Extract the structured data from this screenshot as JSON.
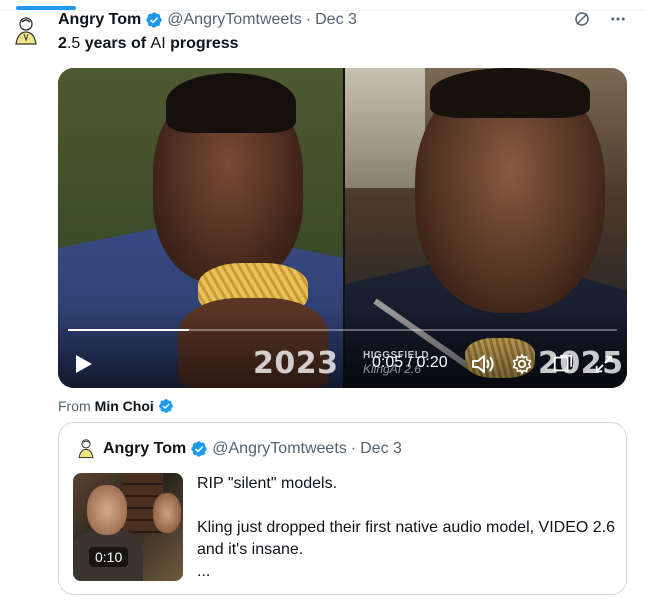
{
  "tweet": {
    "author_name": "Angry Tom",
    "handle": "@AngryTomtweets",
    "separator": "·",
    "date": "Dec 3",
    "text_parts": [
      "2",
      ".5 ",
      "years of ",
      "AI",
      " progress"
    ]
  },
  "media": {
    "year_left": "2023",
    "year_right": "2025",
    "watermark_top": "HIGGSFIELD",
    "watermark_bottom": "KlingAI 2.6",
    "timecode": "0:05 / 0:20",
    "progress": 0.22
  },
  "from": {
    "label": "From",
    "name": "Min Choi"
  },
  "quote": {
    "author_name": "Angry Tom",
    "handle": "@AngryTomtweets",
    "separator": "·",
    "date": "Dec 3",
    "duration": "0:10",
    "line1": "RIP \"silent\" models.",
    "line2": "Kling just dropped their first native audio model, VIDEO 2.6 and it's insane.",
    "line3": "..."
  },
  "colors": {
    "accent": "#1d9bf0",
    "muted": "#536471",
    "border": "#cfd9de"
  },
  "icons": [
    "grok-icon",
    "more-icon",
    "verified-badge-icon",
    "play-icon",
    "volume-icon",
    "settings-icon",
    "pip-icon",
    "fullscreen-icon"
  ]
}
